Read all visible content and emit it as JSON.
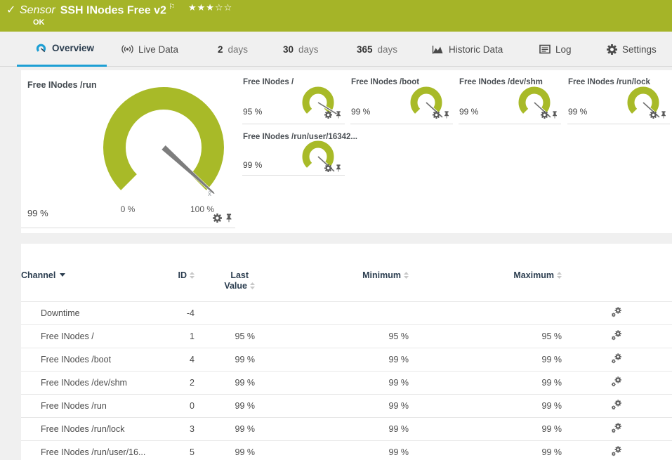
{
  "colors": {
    "status_green": "#a5b428",
    "gauge_green": "#a8ba28",
    "accent_blue": "#1d9fd4",
    "heading_navy": "#2c3e50",
    "needle_gray": "#7d7d7d"
  },
  "header": {
    "check_icon": "✓",
    "type_label": "Sensor",
    "title": "SSH INodes Free v2",
    "flag_icon": "⚐",
    "stars": "★★★☆☆",
    "status": "OK"
  },
  "tabs": {
    "overview": "Overview",
    "live_data": "Live Data",
    "d2_num": "2",
    "d2_unit": "days",
    "d30_num": "30",
    "d30_unit": "days",
    "d365_num": "365",
    "d365_unit": "days",
    "historic": "Historic Data",
    "log": "Log",
    "settings": "Settings"
  },
  "main_gauge": {
    "title": "Free INodes /run",
    "value": "99 %",
    "percent": 99,
    "min_label": "0 %",
    "max_label": "100 %",
    "avg_marker": "x̄"
  },
  "small_gauges": [
    {
      "title": "Free INodes /",
      "value": "95 %",
      "percent": 95
    },
    {
      "title": "Free INodes /boot",
      "value": "99 %",
      "percent": 99
    },
    {
      "title": "Free INodes /dev/shm",
      "value": "99 %",
      "percent": 99
    },
    {
      "title": "Free INodes /run/lock",
      "value": "99 %",
      "percent": 99
    },
    {
      "title": "Free INodes /run/user/16342...",
      "value": "99 %",
      "percent": 99
    }
  ],
  "table": {
    "headers": {
      "channel": "Channel",
      "id": "ID",
      "last_line1": "Last",
      "last_line2": "Value",
      "minimum": "Minimum",
      "maximum": "Maximum"
    },
    "rows": [
      {
        "channel": "Downtime",
        "id": "-4",
        "last": "",
        "min": "",
        "max": ""
      },
      {
        "channel": "Free INodes /",
        "id": "1",
        "last": "95 %",
        "min": "95 %",
        "max": "95 %"
      },
      {
        "channel": "Free INodes /boot",
        "id": "4",
        "last": "99 %",
        "min": "99 %",
        "max": "99 %"
      },
      {
        "channel": "Free INodes /dev/shm",
        "id": "2",
        "last": "99 %",
        "min": "99 %",
        "max": "99 %"
      },
      {
        "channel": "Free INodes /run",
        "id": "0",
        "last": "99 %",
        "min": "99 %",
        "max": "99 %"
      },
      {
        "channel": "Free INodes /run/lock",
        "id": "3",
        "last": "99 %",
        "min": "99 %",
        "max": "99 %"
      },
      {
        "channel": "Free INodes /run/user/16...",
        "id": "5",
        "last": "99 %",
        "min": "99 %",
        "max": "99 %"
      }
    ]
  }
}
